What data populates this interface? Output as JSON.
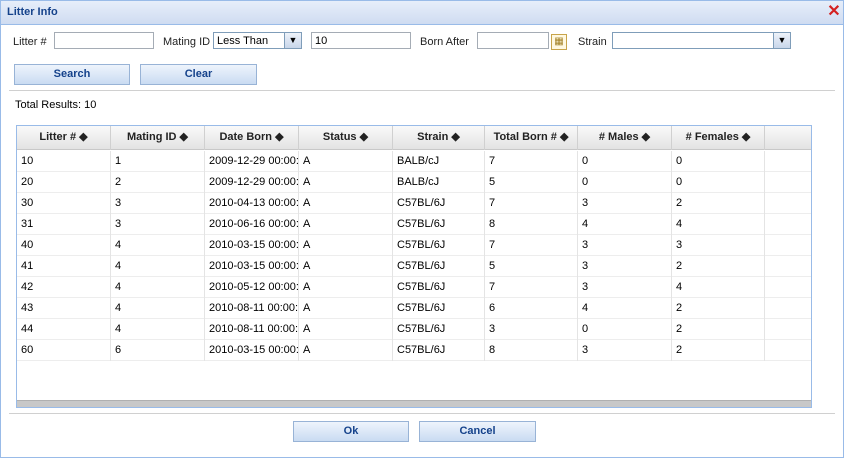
{
  "window": {
    "title": "Litter Info"
  },
  "filters": {
    "litter_label": "Litter #",
    "litter_value": "",
    "mating_label": "Mating ID",
    "mating_operator": "Less Than",
    "mating_value": "10",
    "born_label": "Born After",
    "born_value": "",
    "strain_label": "Strain",
    "strain_value": ""
  },
  "buttons": {
    "search": "Search",
    "clear": "Clear",
    "ok": "Ok",
    "cancel": "Cancel"
  },
  "results": {
    "total_text": "Total Results: 10"
  },
  "table": {
    "columns": [
      {
        "label": "Litter # ◆"
      },
      {
        "label": "Mating ID ◆"
      },
      {
        "label": "Date Born ◆"
      },
      {
        "label": "Status ◆"
      },
      {
        "label": "Strain ◆"
      },
      {
        "label": "Total Born # ◆"
      },
      {
        "label": "# Males ◆"
      },
      {
        "label": "# Females ◆"
      }
    ],
    "rows": [
      [
        "10",
        "1",
        "2009-12-29 00:00:0",
        "A",
        "BALB/cJ",
        "7",
        "0",
        "0"
      ],
      [
        "20",
        "2",
        "2009-12-29 00:00:0",
        "A",
        "BALB/cJ",
        "5",
        "0",
        "0"
      ],
      [
        "30",
        "3",
        "2010-04-13 00:00:0",
        "A",
        "C57BL/6J",
        "7",
        "3",
        "2"
      ],
      [
        "31",
        "3",
        "2010-06-16 00:00:0",
        "A",
        "C57BL/6J",
        "8",
        "4",
        "4"
      ],
      [
        "40",
        "4",
        "2010-03-15 00:00:0",
        "A",
        "C57BL/6J",
        "7",
        "3",
        "3"
      ],
      [
        "41",
        "4",
        "2010-03-15 00:00:0",
        "A",
        "C57BL/6J",
        "5",
        "3",
        "2"
      ],
      [
        "42",
        "4",
        "2010-05-12 00:00:0",
        "A",
        "C57BL/6J",
        "7",
        "3",
        "4"
      ],
      [
        "43",
        "4",
        "2010-08-11 00:00:0",
        "A",
        "C57BL/6J",
        "6",
        "4",
        "2"
      ],
      [
        "44",
        "4",
        "2010-08-11 00:00:0",
        "A",
        "C57BL/6J",
        "3",
        "0",
        "2"
      ],
      [
        "60",
        "6",
        "2010-03-15 00:00:0",
        "A",
        "C57BL/6J",
        "8",
        "3",
        "2"
      ]
    ]
  },
  "icons": {
    "close": "close-icon",
    "calendar": "calendar-icon",
    "dropdown": "chevron-down-icon"
  },
  "colors": {
    "title": "#15428b",
    "border": "#99bbe8",
    "close": "#d42020"
  }
}
